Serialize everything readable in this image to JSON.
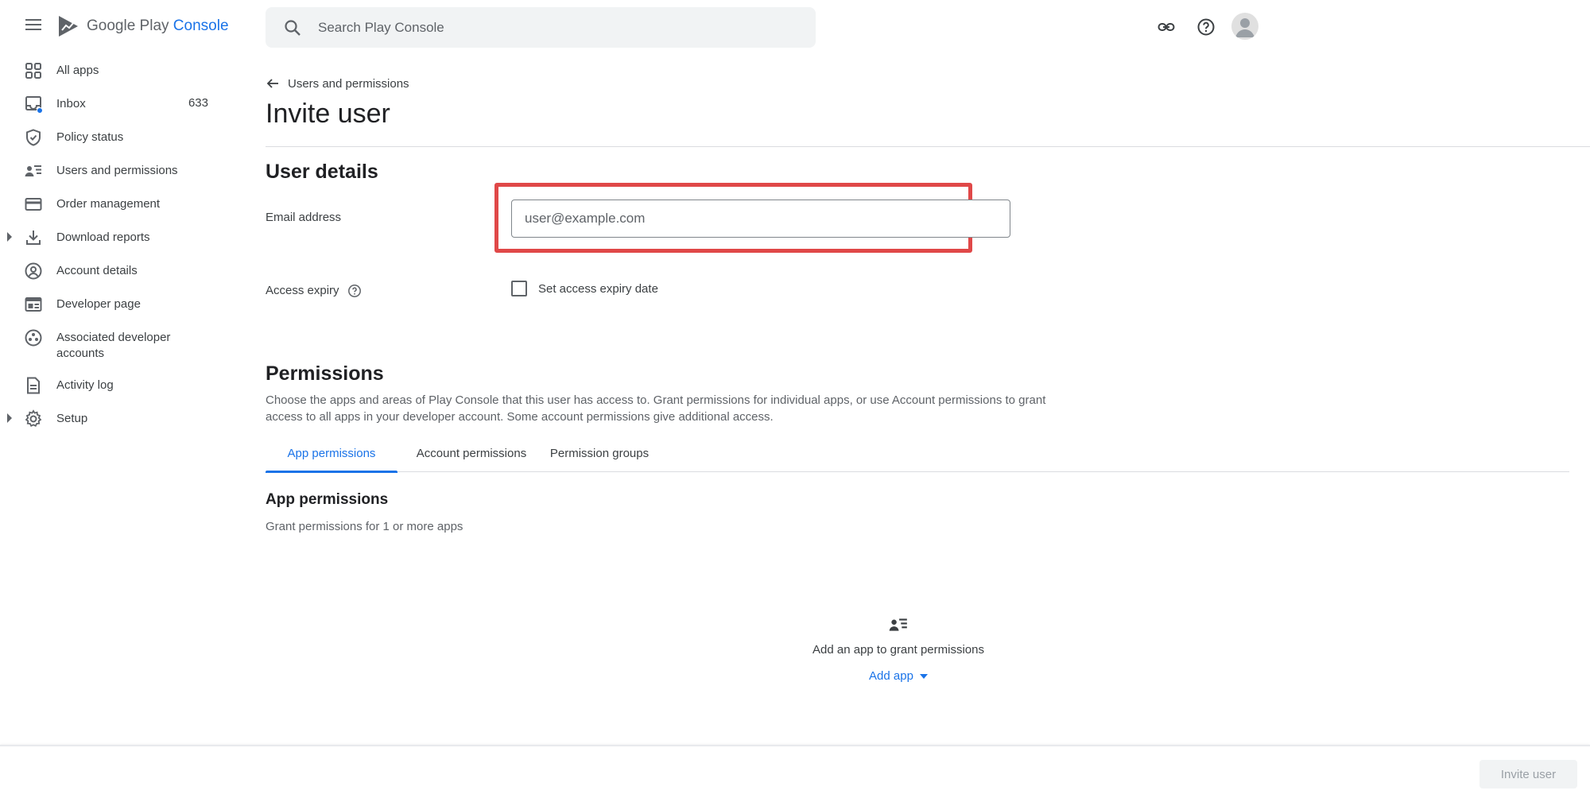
{
  "app": {
    "logo_text_main": "Google Play",
    "logo_text_sub": "Console"
  },
  "search": {
    "placeholder": "Search Play Console"
  },
  "sidebar": {
    "items": [
      {
        "label": "All apps",
        "icon": "apps-grid-icon"
      },
      {
        "label": "Inbox",
        "icon": "inbox-icon",
        "count": "633"
      },
      {
        "label": "Policy status",
        "icon": "shield-check-icon"
      },
      {
        "label": "Users and permissions",
        "icon": "users-list-icon"
      },
      {
        "label": "Order management",
        "icon": "credit-card-icon"
      },
      {
        "label": "Download reports",
        "icon": "download-icon",
        "expandable": true
      },
      {
        "label": "Account details",
        "icon": "account-circle-icon"
      },
      {
        "label": "Developer page",
        "icon": "web-page-icon"
      },
      {
        "label": "Associated developer accounts",
        "icon": "linked-accounts-icon"
      },
      {
        "label": "Activity log",
        "icon": "document-icon"
      },
      {
        "label": "Setup",
        "icon": "gear-icon",
        "expandable": true
      }
    ]
  },
  "main": {
    "breadcrumb": "Users and permissions",
    "title": "Invite user",
    "user_details": {
      "heading": "User details",
      "email_label": "Email address",
      "email_placeholder": "user@example.com",
      "email_value": "",
      "access_expiry_label": "Access expiry",
      "expiry_checkbox_label": "Set access expiry date",
      "expiry_checked": false
    },
    "permissions": {
      "heading": "Permissions",
      "description": "Choose the apps and areas of Play Console that this user has access to. Grant permissions for individual apps, or use Account permissions to grant access to all apps in your developer account. Some account permissions give additional access.",
      "tabs": [
        {
          "label": "App permissions",
          "active": true
        },
        {
          "label": "Account permissions",
          "active": false
        },
        {
          "label": "Permission groups",
          "active": false
        }
      ],
      "sub_heading": "App permissions",
      "sub_description": "Grant permissions for 1 or more apps",
      "empty_text": "Add an app to grant permissions",
      "add_app_label": "Add app"
    }
  },
  "footer": {
    "invite_button": "Invite user",
    "invite_enabled": false
  },
  "colors": {
    "accent": "#1a73e8",
    "highlight": "#e04848",
    "inbox_dot": "#1a73e8"
  }
}
